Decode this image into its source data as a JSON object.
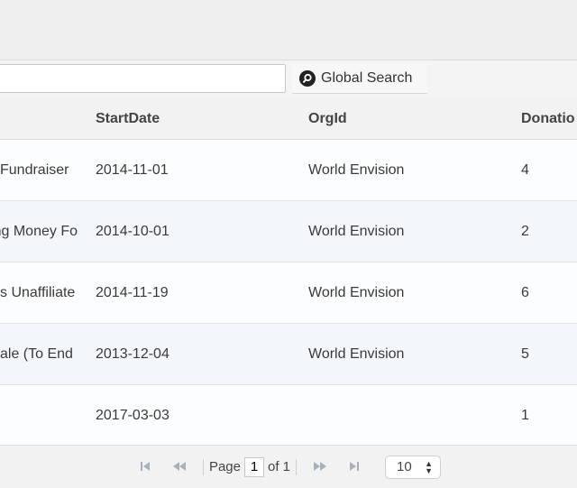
{
  "search": {
    "placeholder": "",
    "button_label": "Global Search"
  },
  "table": {
    "columns": [
      "",
      "StartDate",
      "OrgId",
      "Donatio"
    ],
    "rows": [
      {
        "name": "Fundraiser",
        "start_date": "2014-11-01",
        "org": "World Envision",
        "donations": "4"
      },
      {
        "name": "Raising Money Fo",
        "start_date": "2014-10-01",
        "org": "World Envision",
        "donations": "2"
      },
      {
        "name": "s Unaffiliate",
        "start_date": "2014-11-19",
        "org": "World Envision",
        "donations": "6"
      },
      {
        "name": "ale (To End",
        "start_date": "2013-12-04",
        "org": "World Envision",
        "donations": "5"
      },
      {
        "name": "",
        "start_date": "2017-03-03",
        "org": "",
        "donations": "1"
      }
    ]
  },
  "pager": {
    "page_label": "Page",
    "current_page": "1",
    "of_label": "of 1",
    "page_size": "10",
    "first_icon": "first-page-icon",
    "prev_icon": "prev-page-icon",
    "next_icon": "next-page-icon",
    "last_icon": "last-page-icon"
  }
}
